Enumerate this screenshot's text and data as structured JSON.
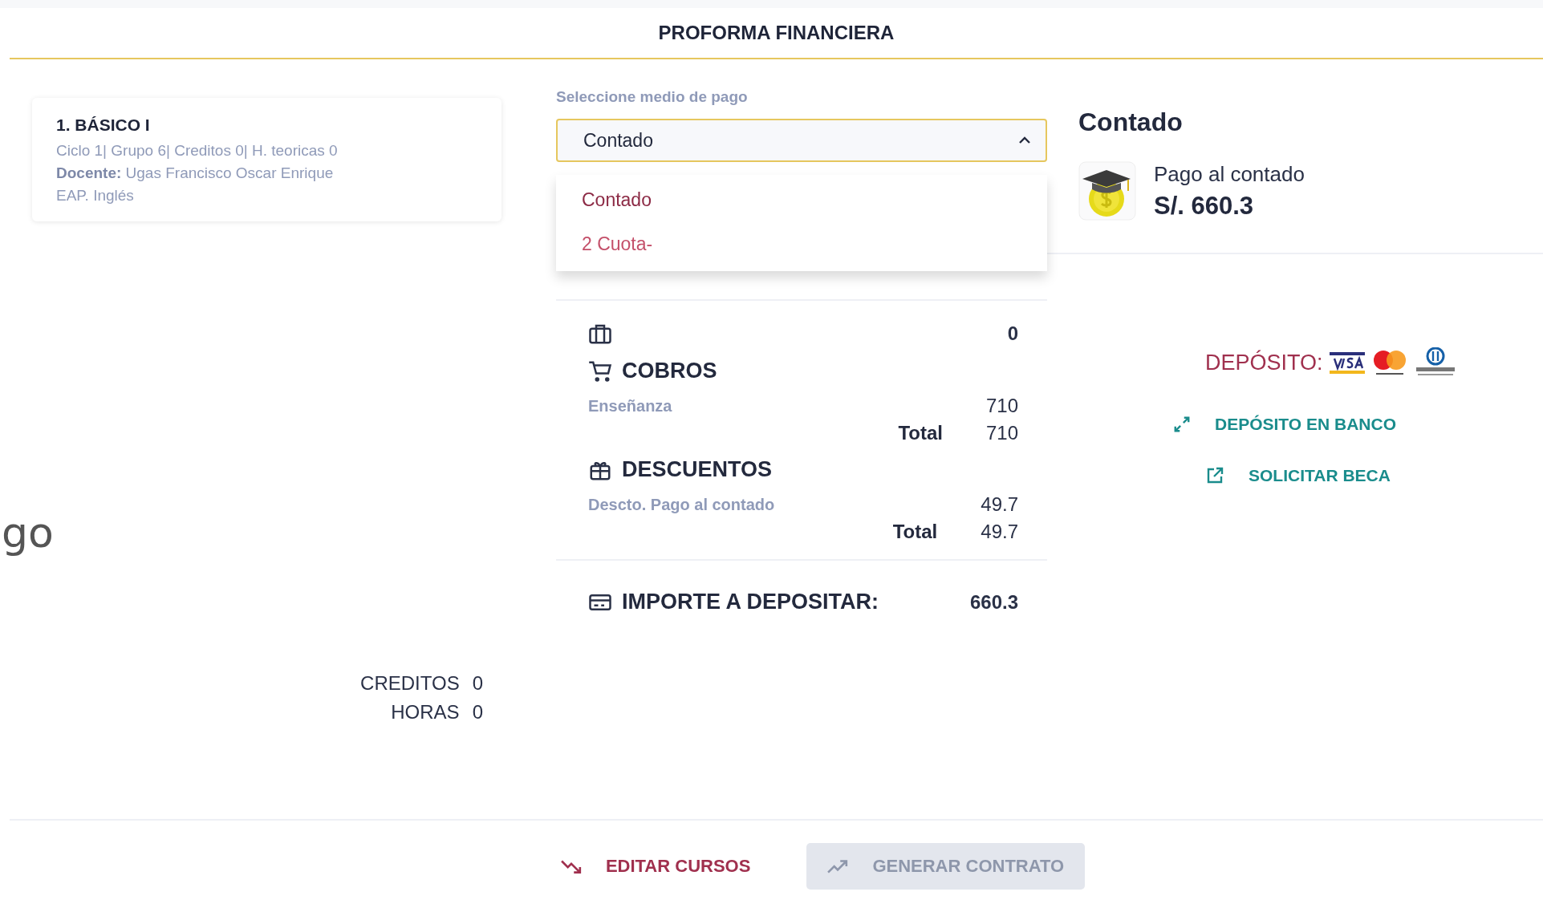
{
  "header": {
    "title": "PROFORMA FINANCIERA"
  },
  "course_card": {
    "title": "1. BÁSICO I",
    "details": "Ciclo 1| Grupo 6| Creditos 0| H. teoricas 0",
    "teacher": "**Docente:** Ugas Francisco Oscar Enrique",
    "program": "EAP. Inglés"
  },
  "left_fragment": "go",
  "summary": [
    {
      "label": "CREDITOS",
      "value": "0"
    },
    {
      "label": "HORAS",
      "value": "0"
    }
  ],
  "payment": {
    "label": "Seleccione medio de pago",
    "value": "Contado",
    "expanded": true,
    "options": [
      {
        "label": "Contado",
        "selected": true
      },
      {
        "label": "2 Cuota-",
        "selected": false
      }
    ]
  },
  "breakdown": {
    "top_value": "0",
    "sections": [
      {
        "kind": "charges",
        "title": "COBROS",
        "items": [
          {
            "label": "Enseñanza",
            "value": "710"
          }
        ],
        "total_label": "Total",
        "total": "710"
      },
      {
        "kind": "discounts",
        "title": "DESCUENTOS",
        "items": [
          {
            "label": "Descto. Pago al contado",
            "value": "49.7"
          }
        ],
        "total_label": "Total",
        "total": "49.7"
      }
    ]
  },
  "amount_due": {
    "label": "IMPORTE A DEPOSITAR:",
    "value": "660.3"
  },
  "plan": {
    "title": "Contado",
    "description": "Pago al contado",
    "amount": "S/. 660.3"
  },
  "deposit": {
    "label": "DEPÓSITO:"
  },
  "links": [
    {
      "kind": "expand",
      "label": "DEPÓSITO EN BANCO"
    },
    {
      "kind": "external",
      "label": "SOLICITAR BECA"
    }
  ],
  "actions": [
    {
      "kind": "edit",
      "label": "EDITAR CURSOS",
      "disabled": false
    },
    {
      "kind": "generate",
      "label": "GENERAR CONTRATO",
      "disabled": true
    }
  ]
}
